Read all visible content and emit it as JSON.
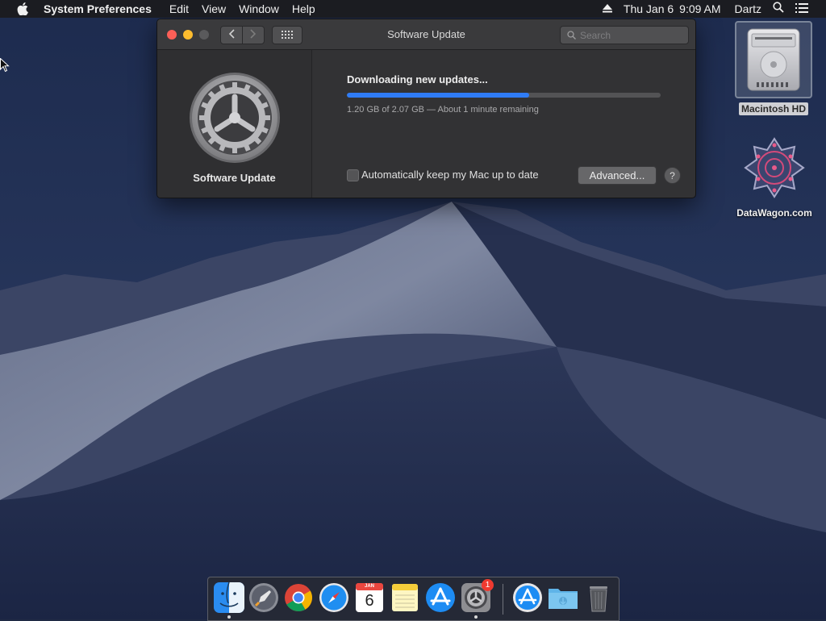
{
  "menubar": {
    "app_name": "System Preferences",
    "menus": [
      "Edit",
      "View",
      "Window",
      "Help"
    ],
    "date": "Thu Jan 6",
    "time": "9:09 AM",
    "user": "Dartz"
  },
  "window": {
    "title": "Software Update",
    "search_placeholder": "Search",
    "pane_label": "Software Update",
    "status": "Downloading new updates...",
    "progress_fraction": 0.58,
    "progress_detail": "1.20 GB of 2.07 GB — About 1 minute remaining",
    "auto_update_label": "Automatically keep my Mac up to date",
    "auto_update_checked": false,
    "advanced_label": "Advanced...",
    "help_label": "?"
  },
  "desktop": {
    "icons": [
      {
        "label": "Macintosh HD",
        "icon": "hard-drive-icon"
      },
      {
        "label": "DataWagon.com",
        "icon": "datawagon-icon"
      }
    ]
  },
  "dock": {
    "items": [
      "finder-icon",
      "launchpad-icon",
      "chrome-icon",
      "safari-icon",
      "calendar-icon",
      "notes-icon",
      "app-store-icon",
      "system-preferences-icon",
      "downloads-app-store-icon",
      "folder-icon",
      "trash-icon"
    ],
    "calendar_month": "JAN",
    "calendar_day": "6",
    "sysprefs_badge": "1"
  },
  "colors": {
    "accent": "#2f7cf6",
    "close": "#fc5f57",
    "minimize": "#fdbc2e"
  }
}
